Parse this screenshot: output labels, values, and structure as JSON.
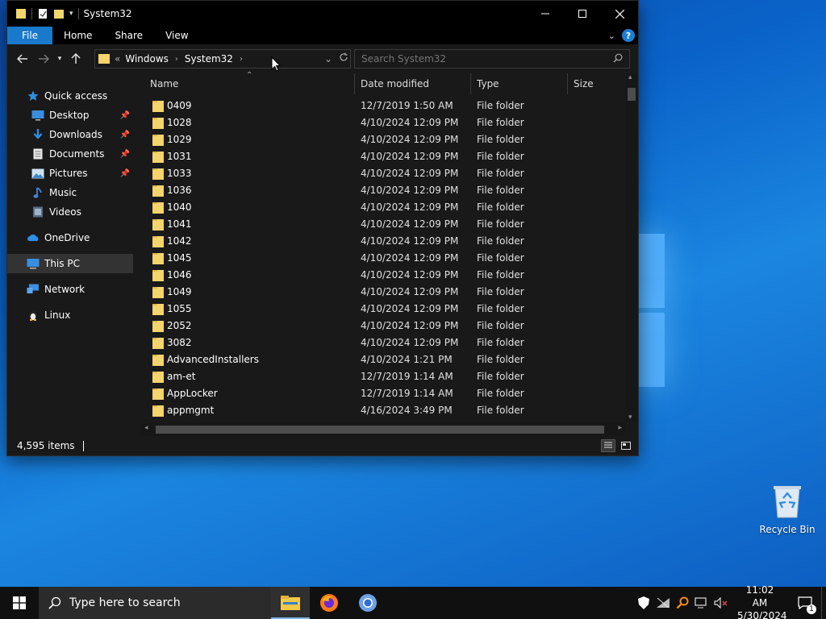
{
  "window": {
    "title": "System32",
    "ribbon_tabs": [
      "File",
      "Home",
      "Share",
      "View"
    ],
    "help_label": "?"
  },
  "address": {
    "overflow": "«",
    "crumbs": [
      "Windows",
      "System32"
    ]
  },
  "search": {
    "placeholder": "Search System32"
  },
  "navpane": {
    "quick_access": "Quick access",
    "items": [
      {
        "label": "Desktop",
        "icon": "desktop-icon",
        "pinned": true
      },
      {
        "label": "Downloads",
        "icon": "downloads-icon",
        "pinned": true
      },
      {
        "label": "Documents",
        "icon": "documents-icon",
        "pinned": true
      },
      {
        "label": "Pictures",
        "icon": "pictures-icon",
        "pinned": true
      },
      {
        "label": "Music",
        "icon": "music-icon",
        "pinned": false
      },
      {
        "label": "Videos",
        "icon": "videos-icon",
        "pinned": false
      }
    ],
    "onedrive": "OneDrive",
    "thispc": "This PC",
    "network": "Network",
    "linux": "Linux"
  },
  "columns": {
    "name": "Name",
    "date": "Date modified",
    "type": "Type",
    "size": "Size"
  },
  "files": [
    {
      "name": "0409",
      "date": "12/7/2019 1:50 AM",
      "type": "File folder"
    },
    {
      "name": "1028",
      "date": "4/10/2024 12:09 PM",
      "type": "File folder"
    },
    {
      "name": "1029",
      "date": "4/10/2024 12:09 PM",
      "type": "File folder"
    },
    {
      "name": "1031",
      "date": "4/10/2024 12:09 PM",
      "type": "File folder"
    },
    {
      "name": "1033",
      "date": "4/10/2024 12:09 PM",
      "type": "File folder"
    },
    {
      "name": "1036",
      "date": "4/10/2024 12:09 PM",
      "type": "File folder"
    },
    {
      "name": "1040",
      "date": "4/10/2024 12:09 PM",
      "type": "File folder"
    },
    {
      "name": "1041",
      "date": "4/10/2024 12:09 PM",
      "type": "File folder"
    },
    {
      "name": "1042",
      "date": "4/10/2024 12:09 PM",
      "type": "File folder"
    },
    {
      "name": "1045",
      "date": "4/10/2024 12:09 PM",
      "type": "File folder"
    },
    {
      "name": "1046",
      "date": "4/10/2024 12:09 PM",
      "type": "File folder"
    },
    {
      "name": "1049",
      "date": "4/10/2024 12:09 PM",
      "type": "File folder"
    },
    {
      "name": "1055",
      "date": "4/10/2024 12:09 PM",
      "type": "File folder"
    },
    {
      "name": "2052",
      "date": "4/10/2024 12:09 PM",
      "type": "File folder"
    },
    {
      "name": "3082",
      "date": "4/10/2024 12:09 PM",
      "type": "File folder"
    },
    {
      "name": "AdvancedInstallers",
      "date": "4/10/2024 1:21 PM",
      "type": "File folder"
    },
    {
      "name": "am-et",
      "date": "12/7/2019 1:14 AM",
      "type": "File folder"
    },
    {
      "name": "AppLocker",
      "date": "12/7/2019 1:14 AM",
      "type": "File folder"
    },
    {
      "name": "appmgmt",
      "date": "4/16/2024 3:49 PM",
      "type": "File folder"
    }
  ],
  "status": {
    "item_count": "4,595 items"
  },
  "desktop": {
    "recycle_bin": "Recycle Bin"
  },
  "taskbar": {
    "search_placeholder": "Type here to search",
    "time": "11:02 AM",
    "date": "5/30/2024",
    "notification_count": "1"
  },
  "colors": {
    "accent": "#1979ca",
    "folder": "#f3d46d",
    "window_bg": "#191919",
    "taskbar": "#101010"
  }
}
